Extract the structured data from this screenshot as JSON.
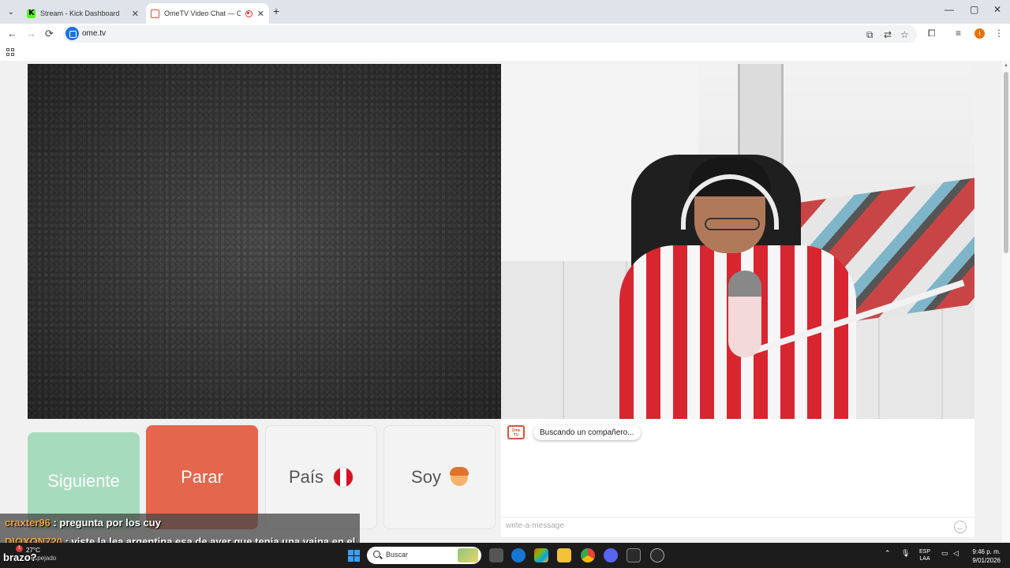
{
  "browser": {
    "tabs": [
      {
        "title": "Stream - Kick Dashboard",
        "favicon": "kick-icon"
      },
      {
        "title": "OmeTV Video Chat — Ome",
        "favicon": "ometv-icon",
        "active": true,
        "recording": true
      }
    ],
    "new_tab": "+",
    "window_controls": {
      "minimize": "—",
      "maximize": "▢",
      "close": "✕"
    },
    "nav": {
      "back": "←",
      "forward": "→",
      "reload": "⟳"
    },
    "url": "ome.tv",
    "profile_initial": "I"
  },
  "main": {
    "buttons": {
      "next": "Siguiente",
      "stop": "Parar",
      "country": "País",
      "me": "Soy"
    },
    "country_flag": "peru-flag",
    "chat": {
      "status_message": "Buscando un compañero...",
      "logo_text": "Ome TV",
      "input_placeholder": "write-a-message"
    }
  },
  "stream_overlay": {
    "messages": [
      {
        "user": "craxter96",
        "text": " : pregunta por los cuy"
      },
      {
        "user": "DIOXON720",
        "text": " : viste la lea argentina esa de ayer que tenia una vaina en el"
      }
    ],
    "continuation": "brazo?"
  },
  "taskbar": {
    "weather_temp": "27°C",
    "weather_desc": "Despejado",
    "weather_badge": "1",
    "search_placeholder": "Buscar",
    "lang_primary": "ESP",
    "lang_secondary": "LAA",
    "time": "9:46 p. m.",
    "date": "9/01/2026"
  },
  "colors": {
    "next_button": "#a6dcbd",
    "stop_button": "#e4664d",
    "username": "#f0a23a"
  }
}
